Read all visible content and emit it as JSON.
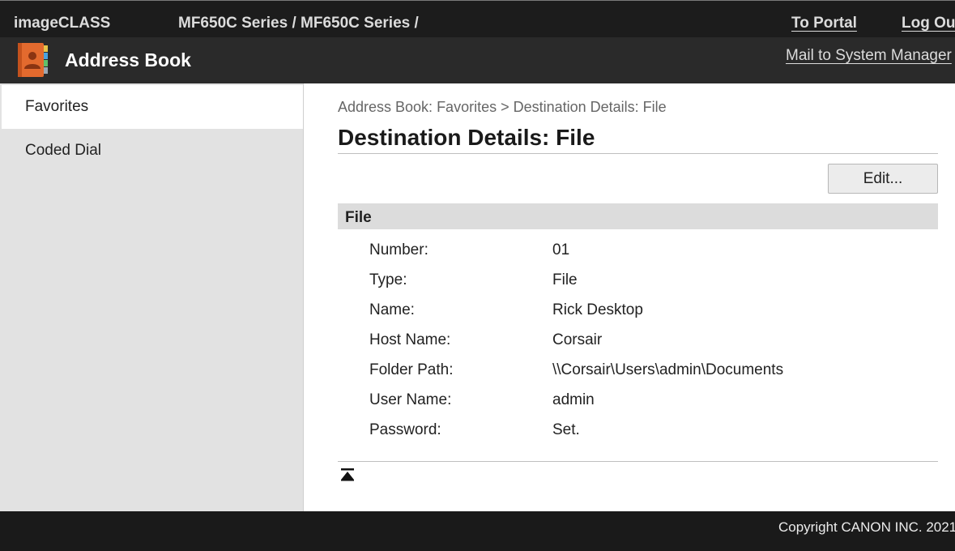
{
  "topbar": {
    "brand": "imageCLASS",
    "device": "MF650C Series / MF650C Series /",
    "to_portal": "To Portal",
    "log_out": "Log Out"
  },
  "header": {
    "title": "Address Book",
    "mail": "Mail to System Manager",
    "icon": "address-book-icon"
  },
  "sidebar": {
    "items": [
      {
        "label": "Favorites",
        "active": true
      },
      {
        "label": "Coded Dial",
        "active": false
      }
    ]
  },
  "main": {
    "breadcrumb": "Address Book: Favorites > Destination Details: File",
    "title": "Destination Details: File",
    "edit_label": "Edit...",
    "section_title": "File",
    "rows": [
      {
        "label": "Number:",
        "value": "01"
      },
      {
        "label": "Type:",
        "value": "File"
      },
      {
        "label": "Name:",
        "value": "Rick Desktop"
      },
      {
        "label": "Host Name:",
        "value": "Corsair"
      },
      {
        "label": "Folder Path:",
        "value": "\\\\Corsair\\Users\\admin\\Documents"
      },
      {
        "label": "User Name:",
        "value": "admin"
      },
      {
        "label": "Password:",
        "value": "Set."
      }
    ],
    "to_top_icon": "to-top-icon"
  },
  "footer": {
    "copyright": "Copyright CANON INC. 2021"
  },
  "colors": {
    "topbar_bg": "#1c1c1c",
    "header_bg": "#2a2a2a",
    "sidebar_bg": "#e2e2e2",
    "section_bg": "#dcdcdc",
    "icon_accent": "#e36a2e"
  }
}
